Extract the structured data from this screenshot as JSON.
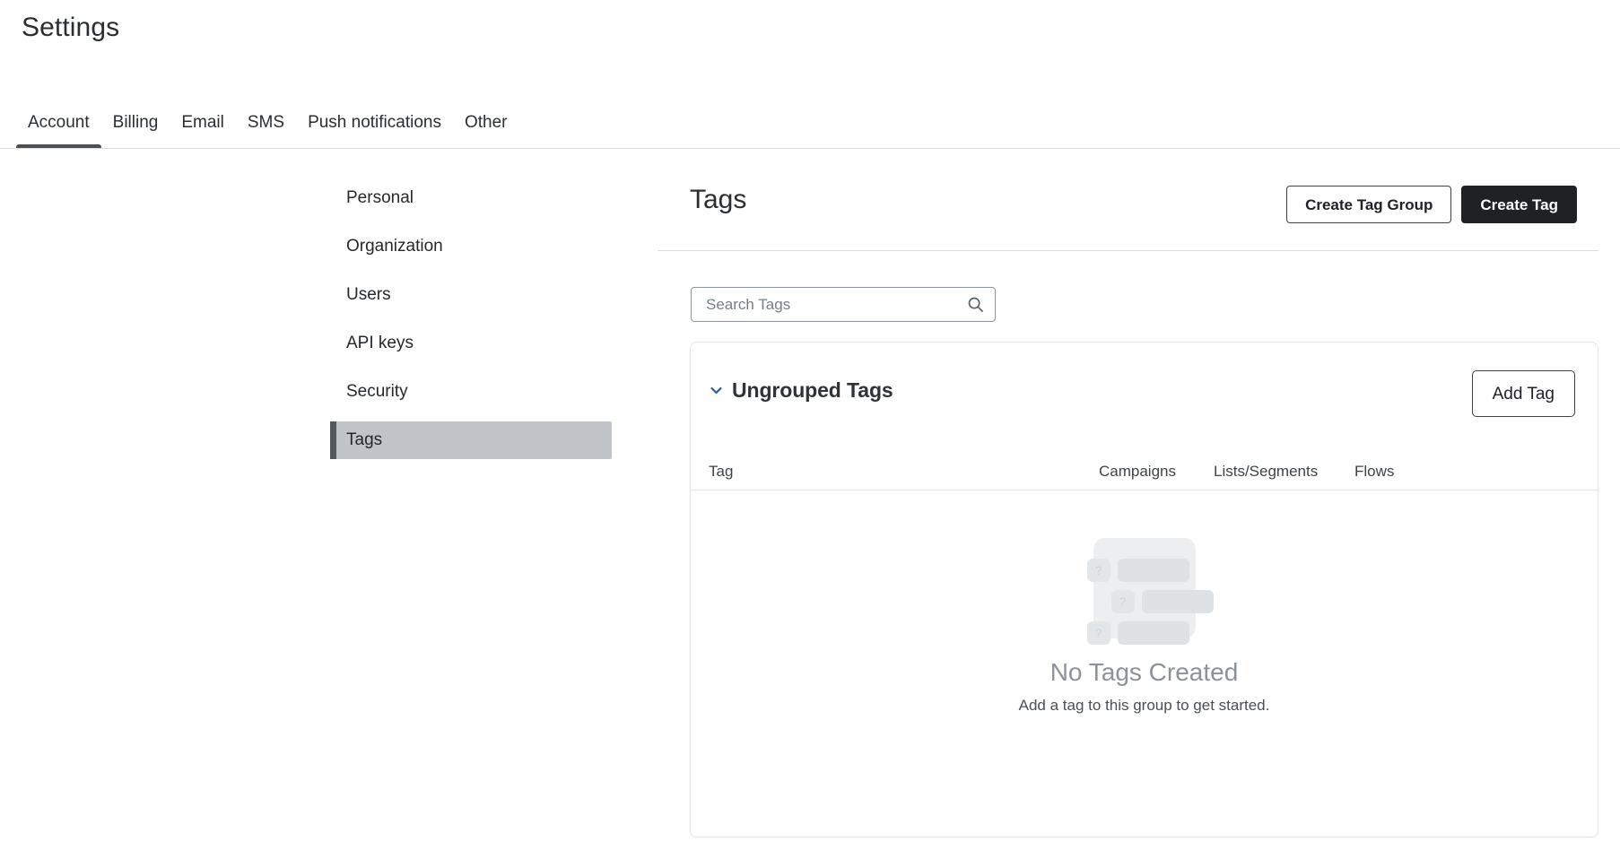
{
  "header": {
    "title": "Settings"
  },
  "tabs": [
    {
      "label": "Account",
      "active": true
    },
    {
      "label": "Billing",
      "active": false
    },
    {
      "label": "Email",
      "active": false
    },
    {
      "label": "SMS",
      "active": false
    },
    {
      "label": "Push notifications",
      "active": false
    },
    {
      "label": "Other",
      "active": false
    }
  ],
  "subnav": {
    "items": [
      {
        "label": "Personal",
        "active": false
      },
      {
        "label": "Organization",
        "active": false
      },
      {
        "label": "Users",
        "active": false
      },
      {
        "label": "API keys",
        "active": false
      },
      {
        "label": "Security",
        "active": false
      },
      {
        "label": "Tags",
        "active": true
      }
    ]
  },
  "main": {
    "title": "Tags",
    "create_tag_group_label": "Create Tag Group",
    "create_tag_label": "Create Tag",
    "search": {
      "placeholder": "Search Tags",
      "value": "",
      "icon": "search-icon"
    },
    "group": {
      "title": "Ungrouped Tags",
      "expanded": true,
      "chevron_icon": "chevron-down-icon",
      "add_tag_label": "Add Tag",
      "columns": [
        "Tag",
        "Campaigns",
        "Lists/Segments",
        "Flows"
      ],
      "rows": [],
      "empty_state": {
        "title": "No Tags Created",
        "subtitle": "Add a tag to this group to get started.",
        "illustration_glyph": "?"
      }
    }
  },
  "colors": {
    "accent_dark": "#1f2124",
    "chevron_blue": "#2a5d9c",
    "active_nav_bg": "#c1c5ca",
    "active_nav_bar": "#52575c",
    "tab_underline": "#4b4f54",
    "empty_title": "#8c929a",
    "border": "#e4e7ea"
  }
}
